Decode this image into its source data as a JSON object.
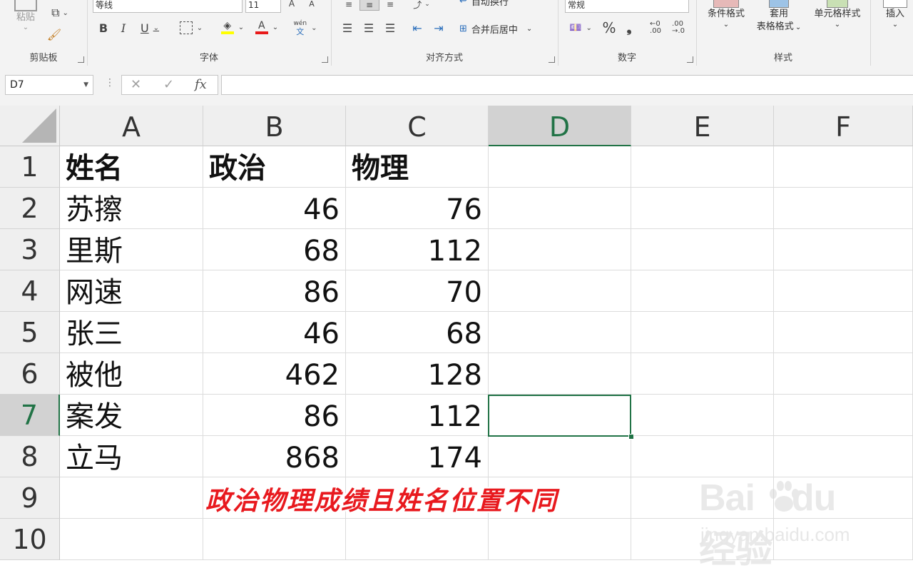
{
  "ribbon": {
    "clipboard": {
      "paste_label": "粘贴",
      "group_label": "剪贴板"
    },
    "font": {
      "font_name": "等线",
      "font_size": "11",
      "group_label": "字体",
      "bold": "B",
      "italic": "I",
      "underline": "U",
      "font_color_glyph": "A",
      "phonetic_top": "wén",
      "phonetic_bottom": "文"
    },
    "alignment": {
      "wrap_text_label": "自动换行",
      "merge_center_label": "合并后居中",
      "group_label": "对齐方式"
    },
    "number": {
      "format_value": "常规",
      "percent": "%",
      "comma": "❟",
      "group_label": "数字"
    },
    "styles": {
      "conditional_label": "条件格式",
      "table_label_1": "套用",
      "table_label_2": "表格格式",
      "cell_styles_label": "单元格样式",
      "group_label": "样式"
    },
    "cells": {
      "insert_label": "插入"
    }
  },
  "formula_bar": {
    "name_box": "D7",
    "cancel": "✕",
    "enter": "✓",
    "fx": "fx",
    "formula": ""
  },
  "sheet": {
    "columns": [
      "A",
      "B",
      "C",
      "D",
      "E",
      "F"
    ],
    "rows": [
      "1",
      "2",
      "3",
      "4",
      "5",
      "6",
      "7",
      "8",
      "9",
      "10"
    ],
    "header_row": [
      "姓名",
      "政治",
      "物理"
    ],
    "data": [
      [
        "苏擦",
        "46",
        "76"
      ],
      [
        "里斯",
        "68",
        "112"
      ],
      [
        "网速",
        "86",
        "70"
      ],
      [
        "张三",
        "46",
        "68"
      ],
      [
        "被他",
        "462",
        "128"
      ],
      [
        "案发",
        "86",
        "112"
      ],
      [
        "立马",
        "868",
        "174"
      ]
    ],
    "active_cell": "D7"
  },
  "overlay": {
    "caption": "政治物理成绩且姓名位置不同",
    "watermark_logo": "Bai du 经验",
    "watermark_url": "jingyan.baidu.com"
  },
  "colors": {
    "accent": "#217346",
    "caption": "#e8191e"
  }
}
